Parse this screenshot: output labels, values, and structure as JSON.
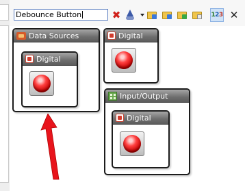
{
  "toolbar": {
    "search_value": "Debounce Button"
  },
  "panels": {
    "data_sources": {
      "title": "Data Sources"
    },
    "digital_nested": {
      "title": "Digital"
    },
    "digital_top": {
      "title": "Digital"
    },
    "input_output": {
      "title": "Input/Output"
    },
    "digital_io": {
      "title": "Digital"
    }
  },
  "icons": {
    "clear": "clear-icon",
    "wizard": "wizard-icon",
    "numbers": "123-icon",
    "close": "close-icon"
  },
  "icon_texts": {
    "numbers": [
      "1",
      "2",
      "3"
    ]
  },
  "colors": {
    "panel_header": "#6e6e6e",
    "button_red": "#e01010",
    "arrow_red": "#e8141c",
    "search_border": "#5b7ec1"
  }
}
